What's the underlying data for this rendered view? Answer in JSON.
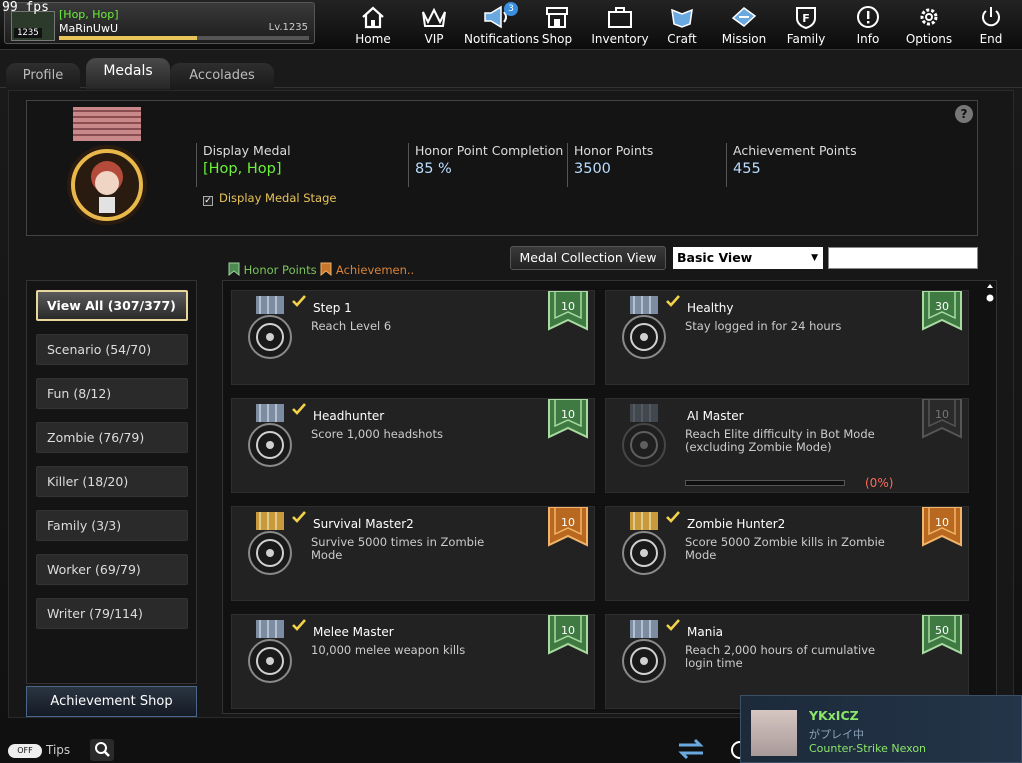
{
  "fps": "99 fps",
  "user": {
    "tag": "[Hop, Hop]",
    "name": "MaRinUwU",
    "level": "Lv.1235",
    "avatar_level": "1235",
    "xp_fraction": 0.55
  },
  "nav": [
    {
      "label": "Home",
      "icon": "home-icon"
    },
    {
      "label": "VIP",
      "icon": "crown-icon"
    },
    {
      "label": "Notifications",
      "icon": "megaphone-icon",
      "badge": "3"
    },
    {
      "label": "Shop",
      "icon": "shop-icon"
    },
    {
      "label": "Inventory",
      "icon": "briefcase-icon"
    },
    {
      "label": "Craft",
      "icon": "craft-icon"
    },
    {
      "label": "Mission",
      "icon": "mission-icon"
    },
    {
      "label": "Family",
      "icon": "family-shield-icon"
    },
    {
      "label": "Info",
      "icon": "info-icon"
    },
    {
      "label": "Options",
      "icon": "gear-icon"
    },
    {
      "label": "End",
      "icon": "power-icon"
    }
  ],
  "tabs": [
    "Profile",
    "Medals",
    "Accolades"
  ],
  "medal": {
    "display_medal_label": "Display Medal",
    "display_medal_value": "[Hop, Hop]",
    "completion_label": "Honor Point Completion",
    "completion_value": "85 %",
    "honor_label": "Honor Points",
    "honor_value": "3500",
    "achievement_label": "Achievement Points",
    "achievement_value": "455",
    "stage_label": "Display Medal Stage",
    "help": "?"
  },
  "legend": {
    "honor": "Honor Points",
    "achievement": "Achievemen.."
  },
  "controls": {
    "collection_view": "Medal Collection View",
    "view_select": "Basic View",
    "search_value": ""
  },
  "categories": [
    "View All (307/377)",
    "Scenario (54/70)",
    "Fun (8/12)",
    "Zombie (76/79)",
    "Killer (18/20)",
    "Family (3/3)",
    "Worker (69/79)",
    "Writer (79/114)"
  ],
  "achievement_shop": "Achievement Shop",
  "cards": [
    {
      "title": "Step 1",
      "desc": "Reach Level 6",
      "points": "10",
      "ribbon": "green",
      "done": true
    },
    {
      "title": "Healthy",
      "desc": "Stay logged in for 24 hours",
      "points": "30",
      "ribbon": "green",
      "done": true
    },
    {
      "title": "Headhunter",
      "desc": "Score 1,000 headshots",
      "points": "10",
      "ribbon": "green",
      "done": true
    },
    {
      "title": "AI Master",
      "desc": "Reach Elite difficulty in Bot Mode (excluding Zombie Mode)",
      "points": "10",
      "ribbon": "grey",
      "done": false,
      "progress": 0,
      "progress_text": "(0%)"
    },
    {
      "title": "Survival Master2",
      "desc": "Survive 5000 times in Zombie Mode",
      "points": "10",
      "ribbon": "orange",
      "done": true
    },
    {
      "title": "Zombie Hunter2",
      "desc": "Score 5000 Zombie kills in Zombie Mode",
      "points": "10",
      "ribbon": "orange",
      "done": true
    },
    {
      "title": "Melee Master",
      "desc": "10,000 melee weapon kills",
      "points": "10",
      "ribbon": "green",
      "done": true
    },
    {
      "title": "Mania",
      "desc": "Reach 2,000 hours of cumulative login time",
      "points": "50",
      "ribbon": "green",
      "done": true
    }
  ],
  "bottom": {
    "tips_label": "Tips",
    "toggle": "OFF"
  },
  "notification": {
    "user": "YKxICZ",
    "status": "がプレイ中",
    "game": "Counter-Strike Nexon"
  },
  "colors": {
    "green": "#4d8a4f",
    "orange": "#c8772a",
    "grey": "#555555",
    "gold": "#e8c45b"
  }
}
